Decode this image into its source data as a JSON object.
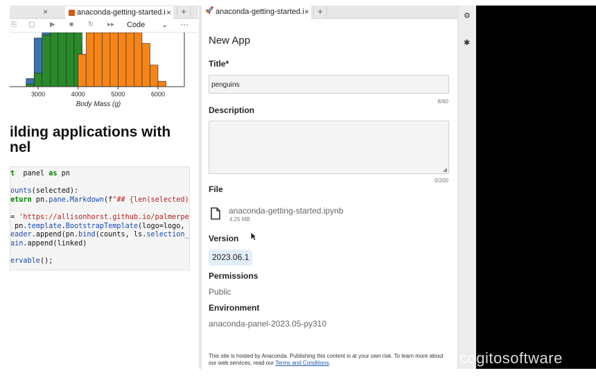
{
  "left_tab": {
    "title": "anaconda-getting-started.i",
    "close": "×",
    "plus": "+",
    "prev_close": "×"
  },
  "notebook_toolbar": {
    "cell_type": "Code"
  },
  "chart_data": {
    "type": "histogram",
    "xlabel": "Body Mass (g)",
    "x_ticks": [
      3000,
      4000,
      5000,
      6000
    ],
    "series": [
      {
        "color": "#3b73b0",
        "bins_x_start": [
          2700,
          2900,
          3100,
          3300,
          3500,
          3700,
          3900,
          4100,
          4300
        ],
        "heights": [
          0.15,
          0.9,
          1.0,
          1.0,
          1.0,
          1.0,
          0.8,
          0.5,
          0.3
        ]
      },
      {
        "color": "#2a8a2a",
        "bins_x_start": [
          2700,
          2900,
          3100,
          3300,
          3500,
          3700,
          3900,
          4100
        ],
        "heights": [
          0.05,
          0.25,
          0.95,
          1.0,
          1.0,
          1.0,
          1.0,
          0.6
        ]
      },
      {
        "color": "#f58518",
        "bins_x_start": [
          4000,
          4200,
          4400,
          4600,
          4800,
          5000,
          5200,
          5400,
          5600,
          5800,
          6000
        ],
        "heights": [
          0.6,
          1.0,
          1.0,
          1.0,
          1.0,
          1.0,
          1.0,
          1.0,
          0.8,
          0.4,
          0.1
        ]
      }
    ]
  },
  "notebook": {
    "heading_line1": "ilding applications with",
    "heading_line2": "nel",
    "code_lines": [
      [
        [
          "kw",
          "t"
        ],
        [
          "",
          "  panel "
        ],
        [
          "kw",
          "as"
        ],
        [
          "",
          " pn"
        ]
      ],
      [],
      [
        [
          "fn",
          "ounts"
        ],
        [
          "",
          "(selected):"
        ]
      ],
      [
        [
          "kw",
          "eturn"
        ],
        [
          "",
          " pn."
        ],
        [
          "attr",
          "pane"
        ],
        [
          "",
          "."
        ],
        [
          "fn",
          "Markdown"
        ],
        [
          "",
          "(f"
        ],
        [
          "str",
          "\"## {len(selected)}/"
        ]
      ],
      [],
      [
        [
          "",
          "= "
        ],
        [
          "str",
          "'https://allisonhorst.github.io/palmerpeng"
        ]
      ],
      [
        [
          "",
          " pn."
        ],
        [
          "attr",
          "template"
        ],
        [
          "",
          "."
        ],
        [
          "fn",
          "BootstrapTemplate"
        ],
        [
          "",
          "(logo=logo, ti"
        ]
      ],
      [
        [
          "fn",
          "eader"
        ],
        [
          "",
          ".append(pn."
        ],
        [
          "fn",
          "bind"
        ],
        [
          "",
          "(counts, ls."
        ],
        [
          "attr",
          "selection_pa"
        ]
      ],
      [
        [
          "fn",
          "ain"
        ],
        [
          "",
          ".append(linked)"
        ]
      ],
      [],
      [
        [
          "fn",
          "ervable"
        ],
        [
          "",
          "()"
        ],
        [
          "",
          ";"
        ]
      ]
    ]
  },
  "right_tab": {
    "title": "anaconda-getting-started.i",
    "close": "×",
    "plus": "+"
  },
  "form": {
    "header": "New App",
    "title_label": "Title*",
    "title_value": "penguins",
    "title_counter": "8/60",
    "description_label": "Description",
    "description_value": "",
    "description_counter": "0/200",
    "file_label": "File",
    "file_name": "anaconda-getting-started.ipynb",
    "file_size": "4.25 MB",
    "version_label": "Version",
    "version_value": "2023.06.1",
    "permissions_label": "Permissions",
    "permissions_value": "Public",
    "environment_label": "Environment",
    "environment_value": "anaconda-panel-2023.05-py310",
    "footer_text": "This site is hosted by Anaconda. Publishing this content is at your own risk. To learn more about our web services, read our ",
    "footer_link": "Terms and Conditions",
    "footer_end": "."
  },
  "watermark": "cogitosoftware"
}
